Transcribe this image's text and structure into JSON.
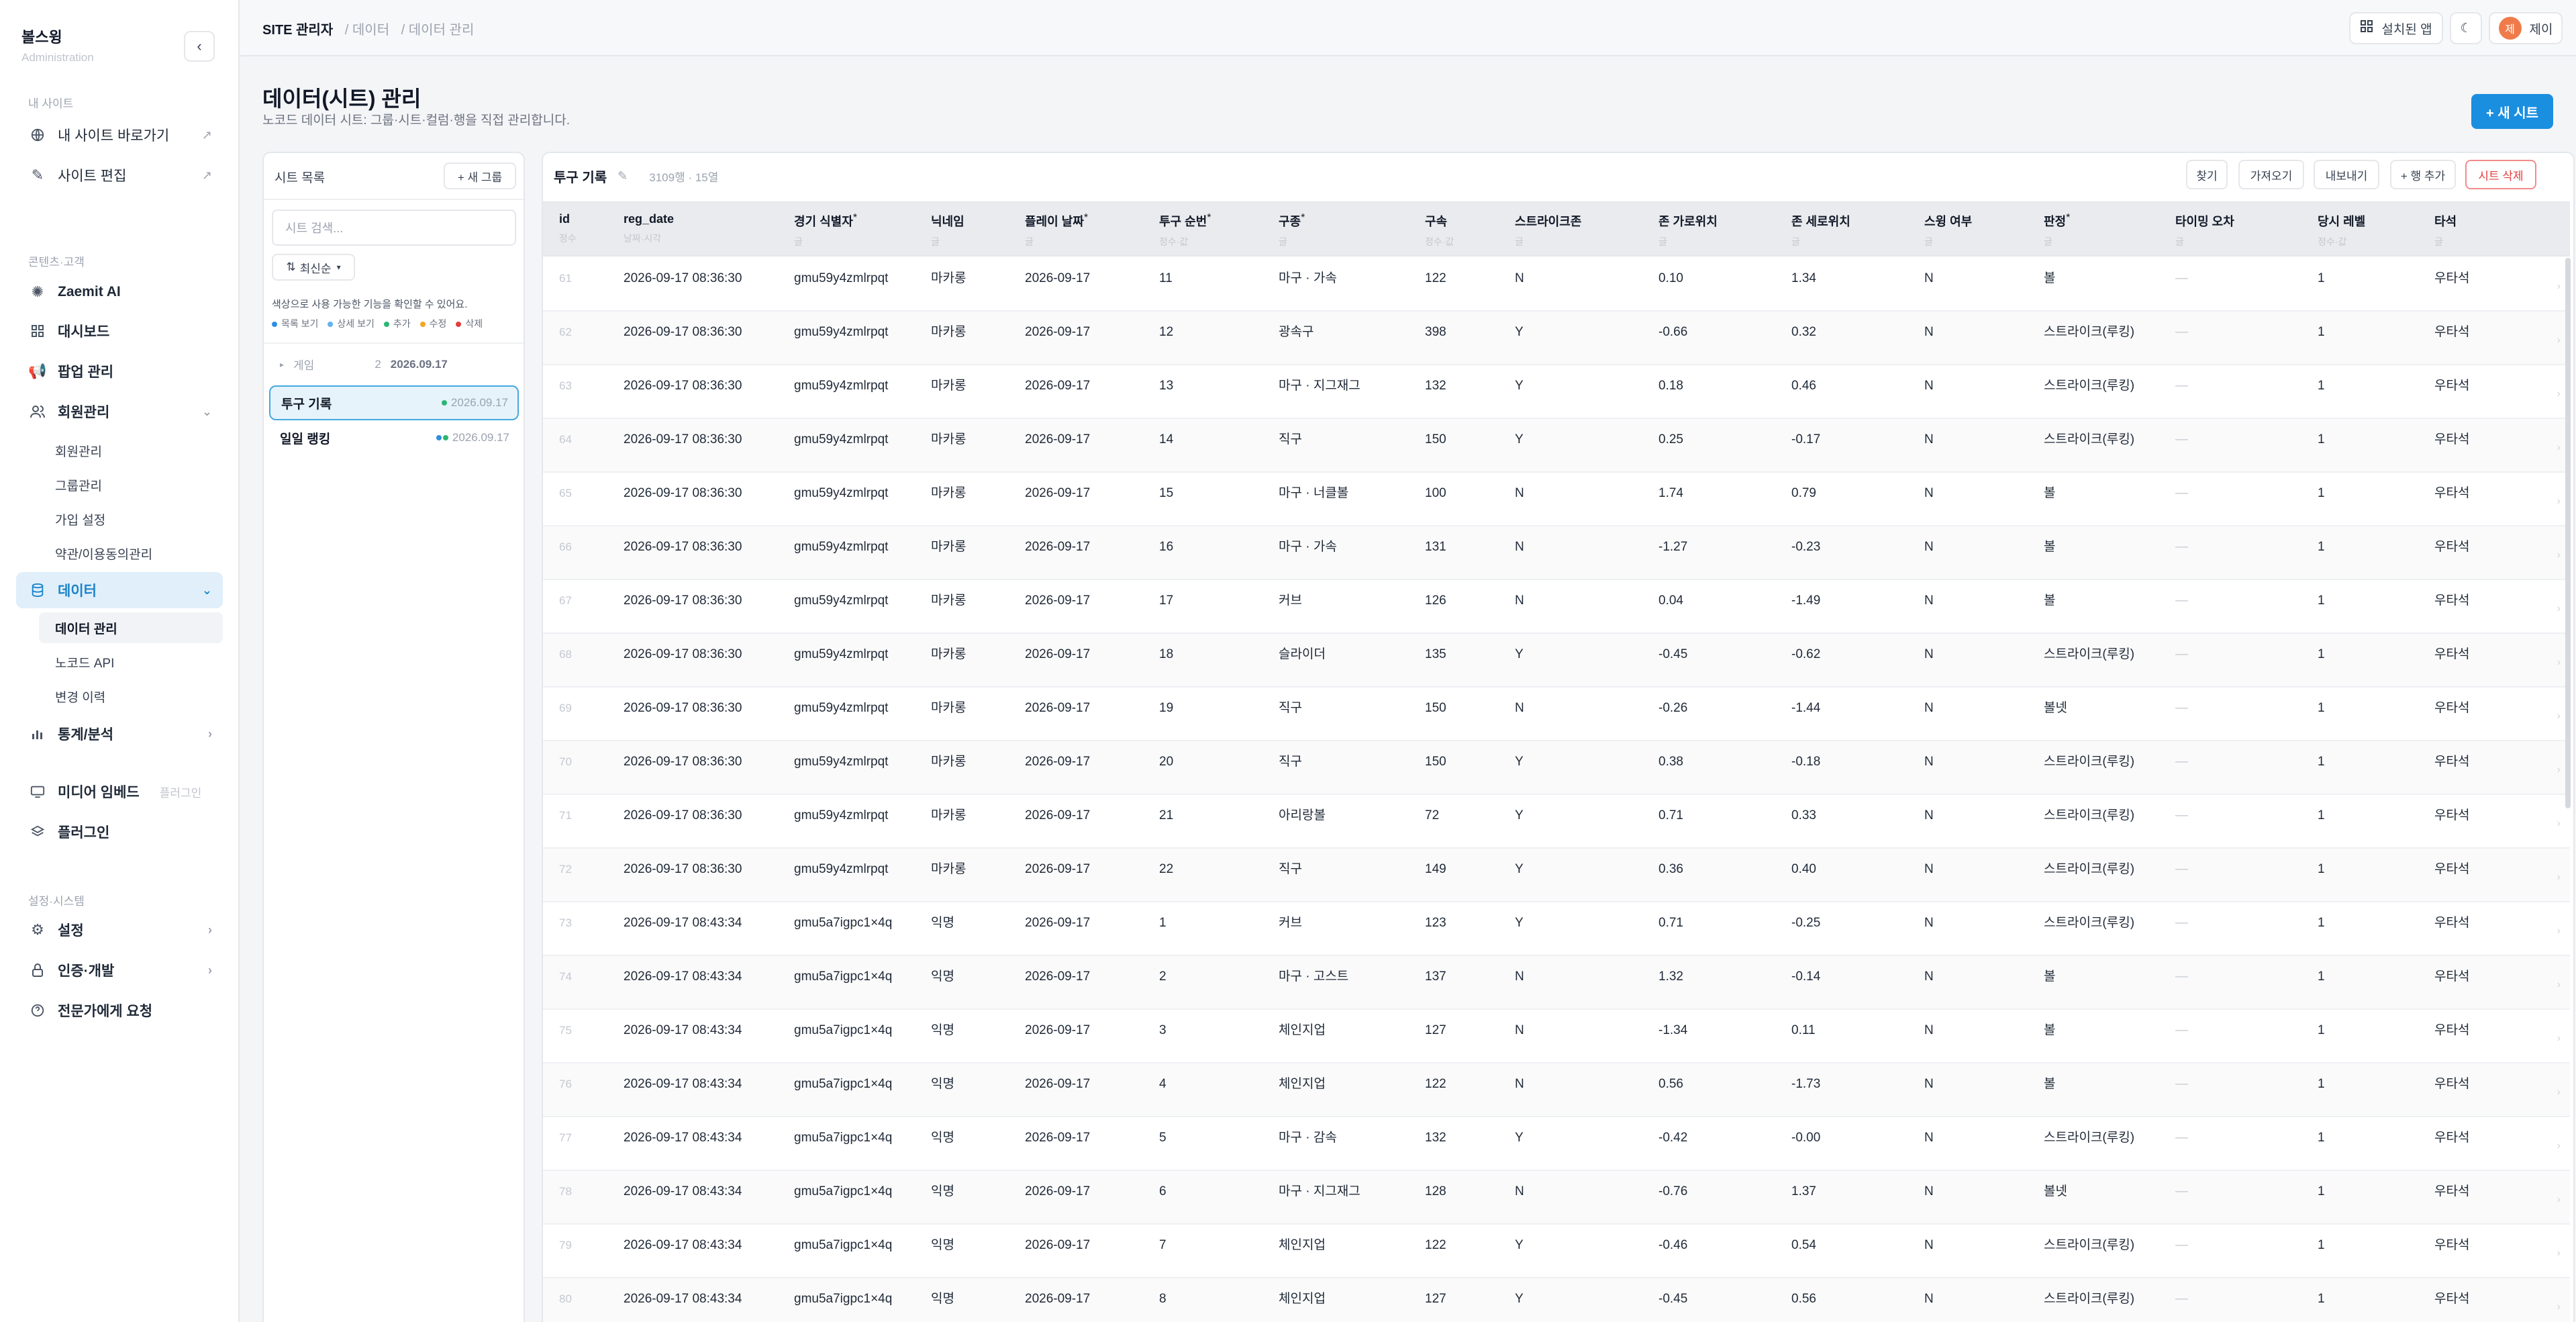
{
  "brand": {
    "name": "볼스윙",
    "sub": "Administration"
  },
  "sidebar": {
    "section_mysite": "내 사이트",
    "go_site": "내 사이트 바로가기",
    "edit_site": "사이트 편집",
    "section_content": "콘텐츠·고객",
    "zaemit_ai": "Zaemit AI",
    "dashboard": "대시보드",
    "popup": "팝업 관리",
    "members": "회원관리",
    "members_sub": [
      "회원관리",
      "그룹관리",
      "가입 설정",
      "약관/이용동의관리"
    ],
    "data": "데이터",
    "data_sub": [
      "데이터 관리",
      "노코드 API",
      "변경 이력"
    ],
    "stats": "통계/분석",
    "media": "미디어 임베드",
    "media_badge": "플러그인",
    "plugins": "플러그인",
    "section_settings": "설정·시스템",
    "settings": "설정",
    "auth_dev": "인증·개발",
    "expert": "전문가에게 요청"
  },
  "topbar": {
    "crumb_root": "SITE 관리자",
    "crumb_mid": "/ 데이터",
    "crumb_leaf": "/ 데이터 관리",
    "installed_apps": "설치된 앱",
    "user_initial": "제",
    "user_name": "제이"
  },
  "page": {
    "title": "데이터(시트) 관리",
    "subtitle": "노코드 데이터 시트: 그룹·시트·컬럼·행을 직접 관리합니다.",
    "new_sheet": "+ 새 시트"
  },
  "sheet_panel": {
    "title": "시트 목록",
    "new_group": "+ 새 그룹",
    "search_placeholder": "시트 검색...",
    "sort_label": "최신순",
    "hint": "색상으로 사용 가능한 기능을 확인할 수 있어요.",
    "legend": [
      {
        "label": "목록 보기",
        "color": "#2f8fe0"
      },
      {
        "label": "상세 보기",
        "color": "#60b3f0"
      },
      {
        "label": "추가",
        "color": "#2bb673"
      },
      {
        "label": "수정",
        "color": "#f5a623"
      },
      {
        "label": "삭제",
        "color": "#e23e3e"
      }
    ],
    "group_name": "게임",
    "group_count": "2",
    "group_date": "2026.09.17",
    "sheets": [
      {
        "name": "투구 기록",
        "date": "2026.09.17"
      },
      {
        "name": "일일 랭킹",
        "date": "2026.09.17"
      }
    ]
  },
  "table": {
    "title": "투구 기록",
    "meta": "3109행 · 15열",
    "buttons": {
      "find": "찾기",
      "import": "가져오기",
      "export": "내보내기",
      "add_row": "+ 행 추가",
      "delete_sheet": "시트 삭제"
    },
    "columns": [
      {
        "name": "id",
        "sub": "정수",
        "req": ""
      },
      {
        "name": "reg_date",
        "sub": "날짜·시각",
        "req": ""
      },
      {
        "name": "경기 식별자",
        "sub": "글",
        "req": "*"
      },
      {
        "name": "닉네임",
        "sub": "글",
        "req": ""
      },
      {
        "name": "플레이 날짜",
        "sub": "글",
        "req": "*"
      },
      {
        "name": "투구 순번",
        "sub": "정수·값",
        "req": "*"
      },
      {
        "name": "구종",
        "sub": "글",
        "req": "*"
      },
      {
        "name": "구속",
        "sub": "정수·값",
        "req": ""
      },
      {
        "name": "스트라이크존",
        "sub": "글",
        "req": ""
      },
      {
        "name": "존 가로위치",
        "sub": "글",
        "req": ""
      },
      {
        "name": "존 세로위치",
        "sub": "글",
        "req": ""
      },
      {
        "name": "스윙 여부",
        "sub": "글",
        "req": ""
      },
      {
        "name": "판정",
        "sub": "글",
        "req": "*"
      },
      {
        "name": "타이밍 오차",
        "sub": "글",
        "req": ""
      },
      {
        "name": "당시 레벨",
        "sub": "정수·값",
        "req": ""
      },
      {
        "name": "타석",
        "sub": "글",
        "req": ""
      }
    ],
    "rows": [
      [
        "61",
        "2026-09-17 08:36:30",
        "gmu59y4zmlrpqt",
        "마카롱",
        "2026-09-17",
        "11",
        "마구 · 가속",
        "122",
        "N",
        "0.10",
        "1.34",
        "N",
        "볼",
        "—",
        "1",
        "우타석"
      ],
      [
        "62",
        "2026-09-17 08:36:30",
        "gmu59y4zmlrpqt",
        "마카롱",
        "2026-09-17",
        "12",
        "광속구",
        "398",
        "Y",
        "-0.66",
        "0.32",
        "N",
        "스트라이크(루킹)",
        "—",
        "1",
        "우타석"
      ],
      [
        "63",
        "2026-09-17 08:36:30",
        "gmu59y4zmlrpqt",
        "마카롱",
        "2026-09-17",
        "13",
        "마구 · 지그재그",
        "132",
        "Y",
        "0.18",
        "0.46",
        "N",
        "스트라이크(루킹)",
        "—",
        "1",
        "우타석"
      ],
      [
        "64",
        "2026-09-17 08:36:30",
        "gmu59y4zmlrpqt",
        "마카롱",
        "2026-09-17",
        "14",
        "직구",
        "150",
        "Y",
        "0.25",
        "-0.17",
        "N",
        "스트라이크(루킹)",
        "—",
        "1",
        "우타석"
      ],
      [
        "65",
        "2026-09-17 08:36:30",
        "gmu59y4zmlrpqt",
        "마카롱",
        "2026-09-17",
        "15",
        "마구 · 너클볼",
        "100",
        "N",
        "1.74",
        "0.79",
        "N",
        "볼",
        "—",
        "1",
        "우타석"
      ],
      [
        "66",
        "2026-09-17 08:36:30",
        "gmu59y4zmlrpqt",
        "마카롱",
        "2026-09-17",
        "16",
        "마구 · 가속",
        "131",
        "N",
        "-1.27",
        "-0.23",
        "N",
        "볼",
        "—",
        "1",
        "우타석"
      ],
      [
        "67",
        "2026-09-17 08:36:30",
        "gmu59y4zmlrpqt",
        "마카롱",
        "2026-09-17",
        "17",
        "커브",
        "126",
        "N",
        "0.04",
        "-1.49",
        "N",
        "볼",
        "—",
        "1",
        "우타석"
      ],
      [
        "68",
        "2026-09-17 08:36:30",
        "gmu59y4zmlrpqt",
        "마카롱",
        "2026-09-17",
        "18",
        "슬라이더",
        "135",
        "Y",
        "-0.45",
        "-0.62",
        "N",
        "스트라이크(루킹)",
        "—",
        "1",
        "우타석"
      ],
      [
        "69",
        "2026-09-17 08:36:30",
        "gmu59y4zmlrpqt",
        "마카롱",
        "2026-09-17",
        "19",
        "직구",
        "150",
        "N",
        "-0.26",
        "-1.44",
        "N",
        "볼넷",
        "—",
        "1",
        "우타석"
      ],
      [
        "70",
        "2026-09-17 08:36:30",
        "gmu59y4zmlrpqt",
        "마카롱",
        "2026-09-17",
        "20",
        "직구",
        "150",
        "Y",
        "0.38",
        "-0.18",
        "N",
        "스트라이크(루킹)",
        "—",
        "1",
        "우타석"
      ],
      [
        "71",
        "2026-09-17 08:36:30",
        "gmu59y4zmlrpqt",
        "마카롱",
        "2026-09-17",
        "21",
        "아리랑볼",
        "72",
        "Y",
        "0.71",
        "0.33",
        "N",
        "스트라이크(루킹)",
        "—",
        "1",
        "우타석"
      ],
      [
        "72",
        "2026-09-17 08:36:30",
        "gmu59y4zmlrpqt",
        "마카롱",
        "2026-09-17",
        "22",
        "직구",
        "149",
        "Y",
        "0.36",
        "0.40",
        "N",
        "스트라이크(루킹)",
        "—",
        "1",
        "우타석"
      ],
      [
        "73",
        "2026-09-17 08:43:34",
        "gmu5a7igpc1×4q",
        "익명",
        "2026-09-17",
        "1",
        "커브",
        "123",
        "Y",
        "0.71",
        "-0.25",
        "N",
        "스트라이크(루킹)",
        "—",
        "1",
        "우타석"
      ],
      [
        "74",
        "2026-09-17 08:43:34",
        "gmu5a7igpc1×4q",
        "익명",
        "2026-09-17",
        "2",
        "마구 · 고스트",
        "137",
        "N",
        "1.32",
        "-0.14",
        "N",
        "볼",
        "—",
        "1",
        "우타석"
      ],
      [
        "75",
        "2026-09-17 08:43:34",
        "gmu5a7igpc1×4q",
        "익명",
        "2026-09-17",
        "3",
        "체인지업",
        "127",
        "N",
        "-1.34",
        "0.11",
        "N",
        "볼",
        "—",
        "1",
        "우타석"
      ],
      [
        "76",
        "2026-09-17 08:43:34",
        "gmu5a7igpc1×4q",
        "익명",
        "2026-09-17",
        "4",
        "체인지업",
        "122",
        "N",
        "0.56",
        "-1.73",
        "N",
        "볼",
        "—",
        "1",
        "우타석"
      ],
      [
        "77",
        "2026-09-17 08:43:34",
        "gmu5a7igpc1×4q",
        "익명",
        "2026-09-17",
        "5",
        "마구 · 감속",
        "132",
        "Y",
        "-0.42",
        "-0.00",
        "N",
        "스트라이크(루킹)",
        "—",
        "1",
        "우타석"
      ],
      [
        "78",
        "2026-09-17 08:43:34",
        "gmu5a7igpc1×4q",
        "익명",
        "2026-09-17",
        "6",
        "마구 · 지그재그",
        "128",
        "N",
        "-0.76",
        "1.37",
        "N",
        "볼넷",
        "—",
        "1",
        "우타석"
      ],
      [
        "79",
        "2026-09-17 08:43:34",
        "gmu5a7igpc1×4q",
        "익명",
        "2026-09-17",
        "7",
        "체인지업",
        "122",
        "Y",
        "-0.46",
        "0.54",
        "N",
        "스트라이크(루킹)",
        "—",
        "1",
        "우타석"
      ],
      [
        "80",
        "2026-09-17 08:43:34",
        "gmu5a7igpc1×4q",
        "익명",
        "2026-09-17",
        "8",
        "체인지업",
        "127",
        "Y",
        "-0.45",
        "0.56",
        "N",
        "스트라이크(루킹)",
        "—",
        "1",
        "우타석"
      ]
    ]
  },
  "colors": {
    "accent": "#1a8fe0",
    "danger": "#e23e3e",
    "active_bg": "#e0effa"
  },
  "icons": [
    "chevron-left-icon",
    "globe-icon",
    "pencil-icon",
    "external-link-icon",
    "sparkle-icon",
    "grid-icon",
    "megaphone-icon",
    "users-icon",
    "database-icon",
    "bar-chart-icon",
    "monitor-icon",
    "layers-icon",
    "gear-icon",
    "lock-icon",
    "help-icon",
    "moon-icon",
    "apps-icon",
    "sort-icon",
    "edit-icon"
  ]
}
